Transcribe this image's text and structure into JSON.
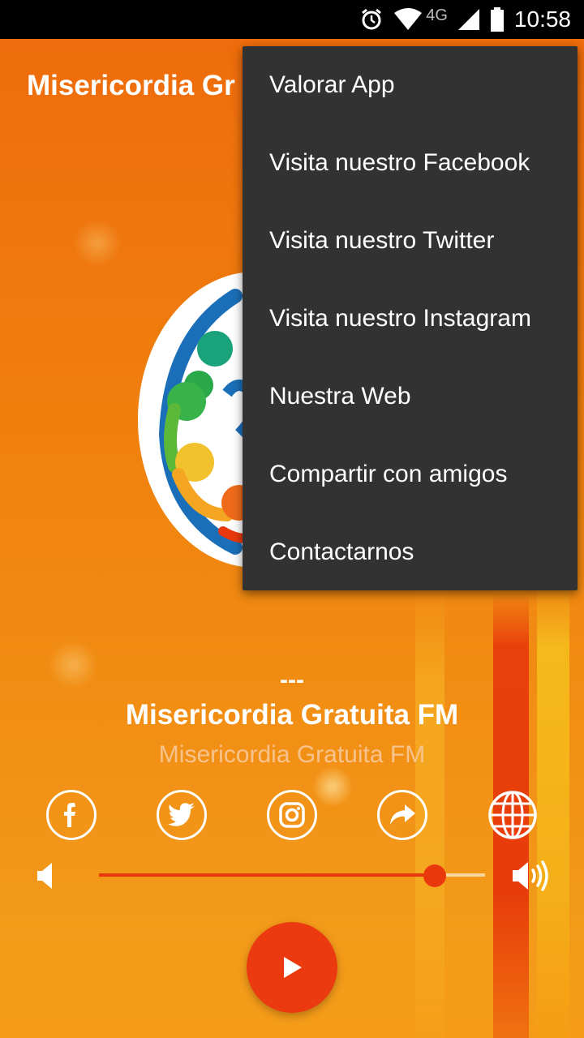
{
  "status_bar": {
    "network": "4G",
    "time": "10:58",
    "icons": [
      "alarm-icon",
      "wifi-icon",
      "signal-icon",
      "battery-icon"
    ]
  },
  "app_bar": {
    "title": "Misericordia Gr"
  },
  "overflow_menu": {
    "items": [
      {
        "label": "Valorar App"
      },
      {
        "label": "Visita nuestro Facebook"
      },
      {
        "label": "Visita nuestro Twitter"
      },
      {
        "label": "Visita nuestro Instagram"
      },
      {
        "label": "Nuestra Web"
      },
      {
        "label": "Compartir con amigos"
      },
      {
        "label": "Contactarnos"
      }
    ]
  },
  "now_playing": {
    "track": "---",
    "station": "Misericordia Gratuita FM",
    "subtitle": "Misericordia Gratuita FM"
  },
  "social_icons": [
    "facebook-icon",
    "twitter-icon",
    "instagram-icon",
    "share-icon",
    "globe-icon"
  ],
  "volume": {
    "level": 0.87
  },
  "colors": {
    "accent": "#e8380c",
    "menu_bg": "#323232",
    "background": "#f07a10"
  }
}
